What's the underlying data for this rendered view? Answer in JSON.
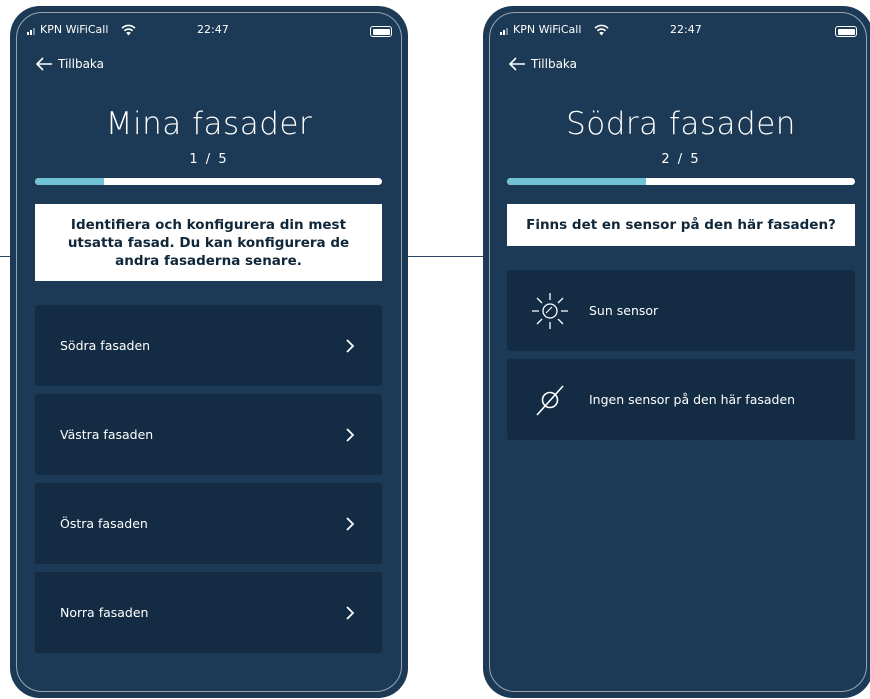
{
  "screens": [
    {
      "status": {
        "carrier": "KPN WiFiCall",
        "time": "22:47"
      },
      "back_label": "Tillbaka",
      "title": "Mina fasader",
      "progress_text": "1 / 5",
      "progress_fraction": 0.2,
      "info_text": "Identifiera och konfigurera din mest utsatta fasad. Du kan konfigurera de andra fasaderna senare.",
      "options": [
        {
          "label": "Södra fasaden",
          "icon": "chevron-right-icon"
        },
        {
          "label": "Västra fasaden",
          "icon": "chevron-right-icon"
        },
        {
          "label": "Östra fasaden",
          "icon": "chevron-right-icon"
        },
        {
          "label": "Norra fasaden",
          "icon": "chevron-right-icon"
        }
      ]
    },
    {
      "status": {
        "carrier": "KPN WiFiCall",
        "time": "22:47"
      },
      "back_label": "Tillbaka",
      "title": "Södra fasaden",
      "progress_text": "2 / 5",
      "progress_fraction": 0.4,
      "info_text": "Finns det en sensor på den här fasaden?",
      "options": [
        {
          "label": "Sun sensor",
          "icon": "sun-sensor-icon"
        },
        {
          "label": "Ingen sensor på den här fasaden",
          "icon": "no-sensor-icon"
        }
      ]
    }
  ],
  "colors": {
    "background": "#1c3a55",
    "card": "#132c43",
    "progress_fill": "#6fc1d3",
    "info_box": "#ffffff"
  }
}
